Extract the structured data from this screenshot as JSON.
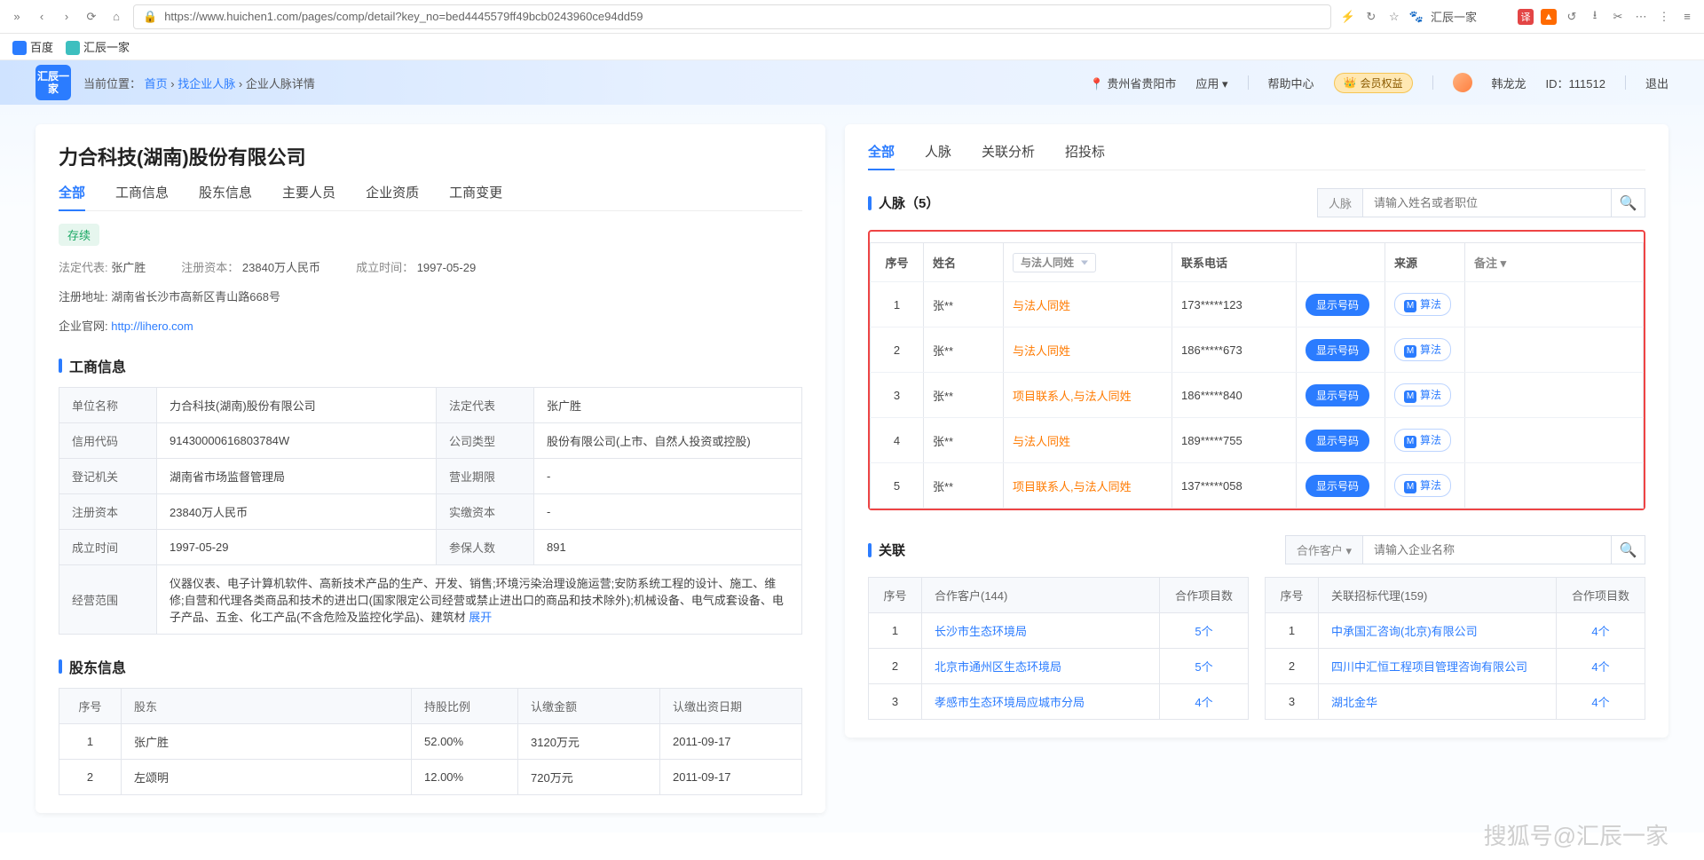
{
  "chrome": {
    "url": "https://www.huichen1.com/pages/comp/detail?key_no=bed4445579ff49bcb0243960ce94dd59",
    "ext_label": "汇辰一家"
  },
  "bookmarks": [
    {
      "label": "百度"
    },
    {
      "label": "汇辰一家"
    }
  ],
  "banner": {
    "logo": "汇辰一家",
    "crumb_label": "当前位置：",
    "crumb_home": "首页",
    "crumb_mid": "找企业人脉",
    "crumb_last": "企业人脉详情",
    "location": "贵州省贵阳市",
    "app_label": "应用 ▾",
    "help": "帮助中心",
    "member": "会员权益",
    "user_name": "韩龙龙",
    "user_id_label": "ID：",
    "user_id": "111512",
    "logout": "退出"
  },
  "left": {
    "company_name": "力合科技(湖南)股份有限公司",
    "tabs": [
      "全部",
      "工商信息",
      "股东信息",
      "主要人员",
      "企业资质",
      "工商变更"
    ],
    "status": "存续",
    "legal_lab": "法定代表:",
    "legal_val": "张广胜",
    "cap_lab": "注册资本：",
    "cap_val": "23840万人民币",
    "est_lab": "成立时间：",
    "est_val": "1997-05-29",
    "addr_lab": "注册地址:",
    "addr_val": "湖南省长沙市高新区青山路668号",
    "site_lab": "企业官网:",
    "site_val": "http://lihero.com",
    "section_biz": "工商信息",
    "biz_rows": [
      [
        "单位名称",
        "力合科技(湖南)股份有限公司",
        "法定代表",
        "张广胜"
      ],
      [
        "信用代码",
        "91430000616803784W",
        "公司类型",
        "股份有限公司(上市、自然人投资或控股)"
      ],
      [
        "登记机关",
        "湖南省市场监督管理局",
        "营业期限",
        "-"
      ],
      [
        "注册资本",
        "23840万人民币",
        "实缴资本",
        "-"
      ],
      [
        "成立时间",
        "1997-05-29",
        "参保人数",
        "891"
      ]
    ],
    "scope_label": "经营范围",
    "scope_text": "仪器仪表、电子计算机软件、高新技术产品的生产、开发、销售;环境污染治理设施运营;安防系统工程的设计、施工、维修;自营和代理各类商品和技术的进出口(国家限定公司经营或禁止进出口的商品和技术除外);机械设备、电气成套设备、电子产品、五金、化工产品(不含危险及监控化学品)、建筑材",
    "expand": "展开",
    "section_sh": "股东信息",
    "sh_headers": [
      "序号",
      "股东",
      "持股比例",
      "认缴金额",
      "认缴出资日期"
    ],
    "sh_rows": [
      [
        "1",
        "张广胜",
        "52.00%",
        "3120万元",
        "2011-09-17"
      ],
      [
        "2",
        "左颂明",
        "12.00%",
        "720万元",
        "2011-09-17"
      ]
    ]
  },
  "right": {
    "tabs": [
      "全部",
      "人脉",
      "关联分析",
      "招投标"
    ],
    "people_title": "人脉（5）",
    "people_sel": "人脉",
    "people_placeholder": "请输入姓名或者职位",
    "tbl_h": [
      "序号",
      "姓名",
      "",
      "联系电话",
      "",
      "来源",
      "备注 ▾"
    ],
    "filter_sel": "与法人同姓",
    "rows": [
      {
        "idx": "1",
        "name": "张**",
        "tag": "与法人同姓",
        "phone": "173*****123",
        "btn": "显示号码",
        "src": "算法"
      },
      {
        "idx": "2",
        "name": "张**",
        "tag": "与法人同姓",
        "phone": "186*****673",
        "btn": "显示号码",
        "src": "算法"
      },
      {
        "idx": "3",
        "name": "张**",
        "tag": "项目联系人,与法人同姓",
        "phone": "186*****840",
        "btn": "显示号码",
        "src": "算法"
      },
      {
        "idx": "4",
        "name": "张**",
        "tag": "与法人同姓",
        "phone": "189*****755",
        "btn": "显示号码",
        "src": "算法"
      },
      {
        "idx": "5",
        "name": "张**",
        "tag": "项目联系人,与法人同姓",
        "phone": "137*****058",
        "btn": "显示号码",
        "src": "算法"
      }
    ],
    "rel_title": "关联",
    "rel_sel": "合作客户 ▾",
    "rel_placeholder": "请输入企业名称",
    "rel_left_h": [
      "序号",
      "合作客户(144)",
      "合作项目数"
    ],
    "rel_left": [
      [
        "1",
        "长沙市生态环境局",
        "5个"
      ],
      [
        "2",
        "北京市通州区生态环境局",
        "5个"
      ],
      [
        "3",
        "孝感市生态环境局应城市分局",
        "4个"
      ]
    ],
    "rel_right_h": [
      "序号",
      "关联招标代理(159)",
      "合作项目数"
    ],
    "rel_right": [
      [
        "1",
        "中承国汇咨询(北京)有限公司",
        "4个"
      ],
      [
        "2",
        "四川中汇恒工程项目管理咨询有限公司",
        "4个"
      ],
      [
        "3",
        "湖北金华",
        "4个"
      ]
    ]
  },
  "watermark": "搜狐号@汇辰一家"
}
